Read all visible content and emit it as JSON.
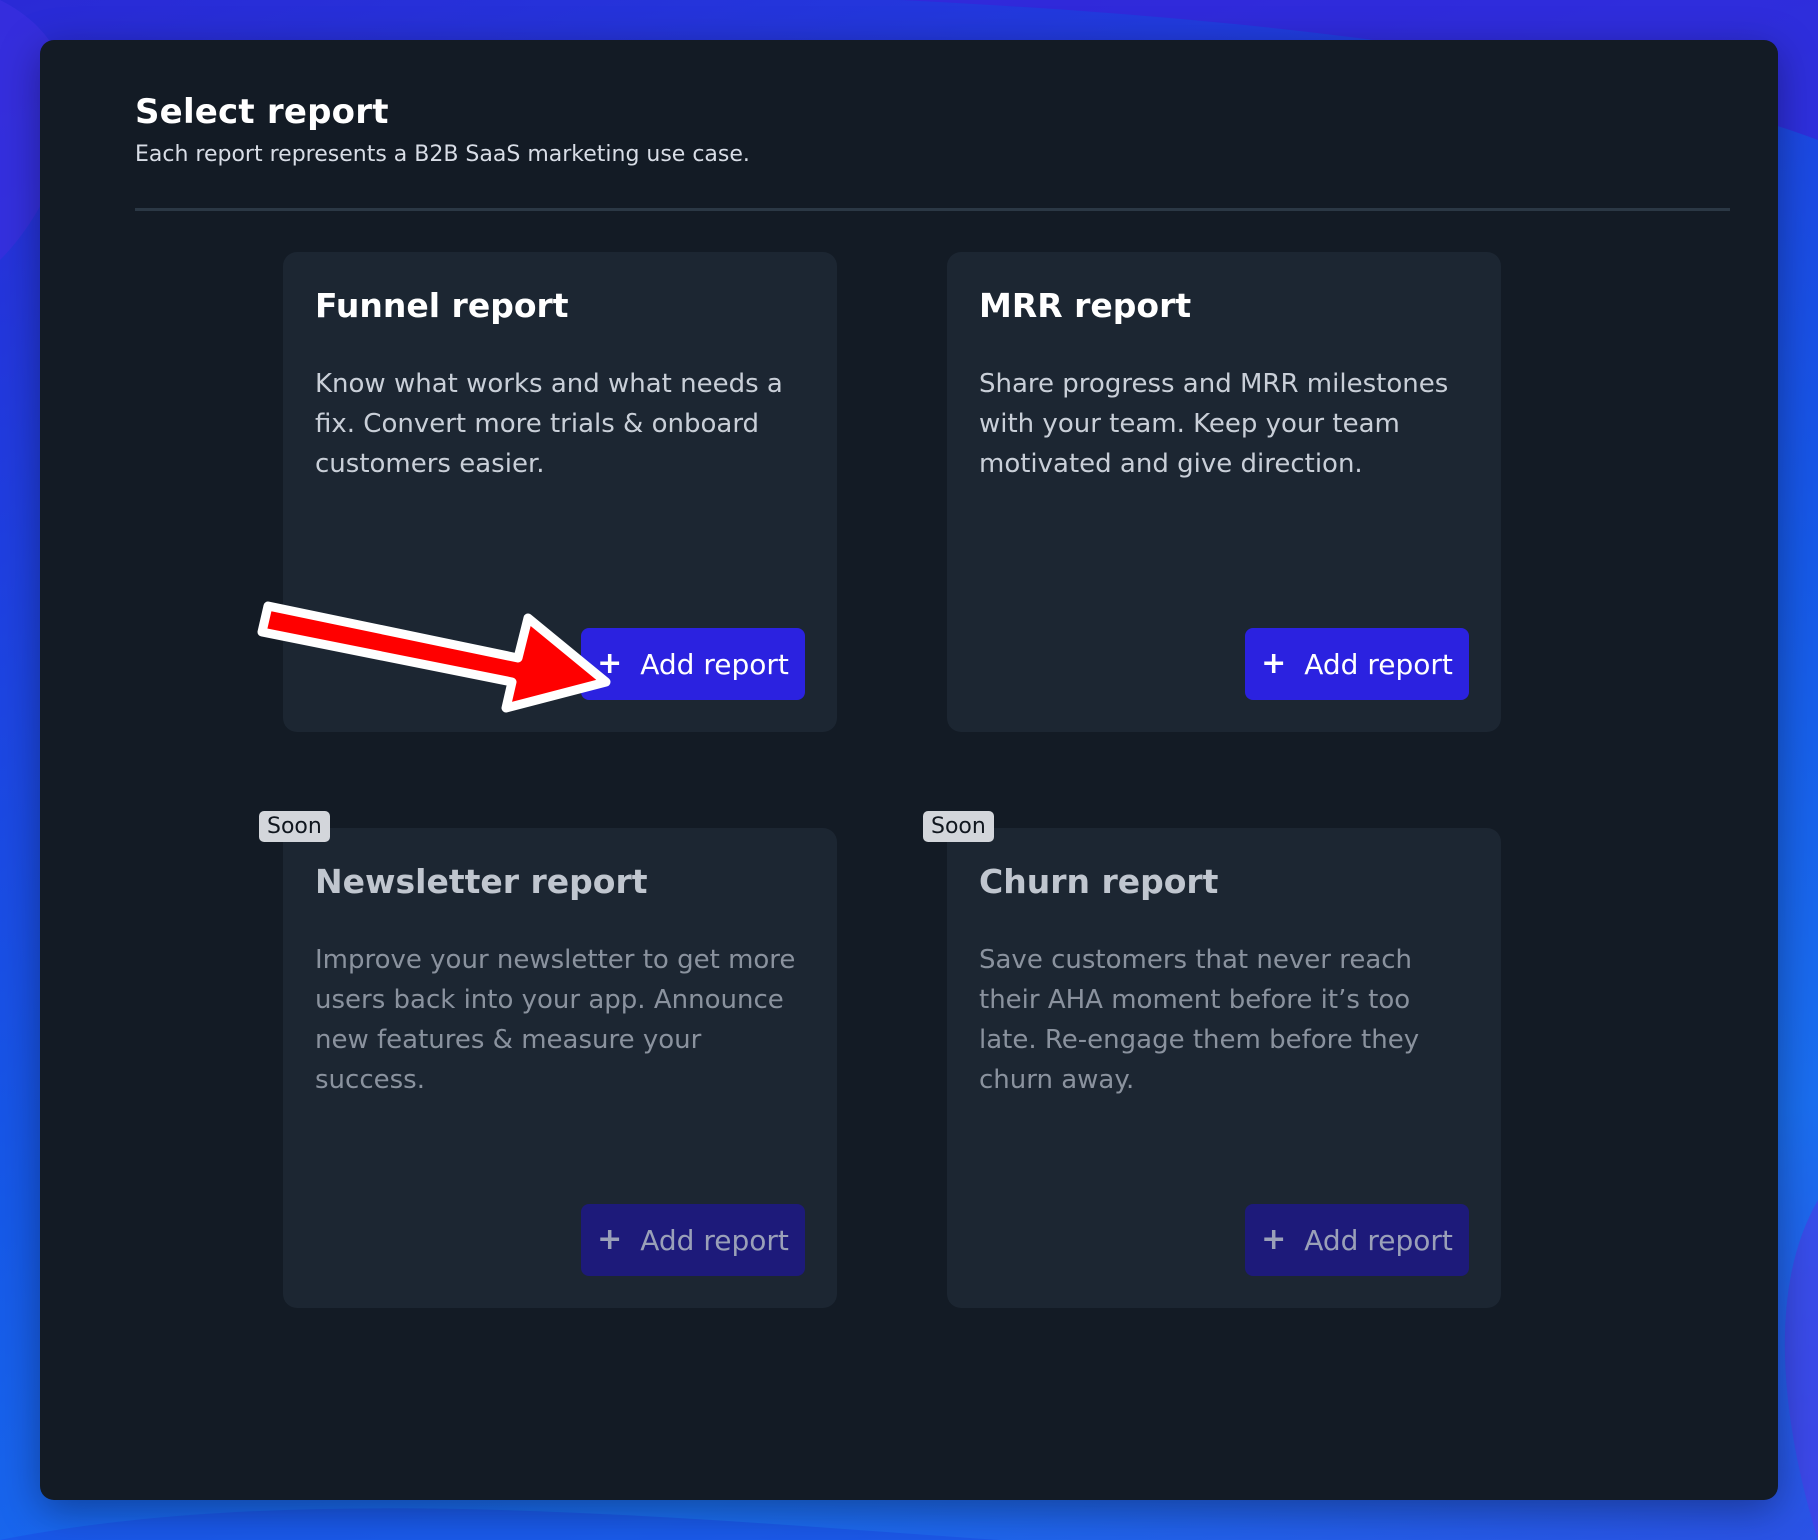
{
  "header": {
    "title": "Select report",
    "subtitle": "Each report represents a B2B SaaS marketing use case."
  },
  "cards": [
    {
      "title": "Funnel report",
      "description": "Know what works and what needs a fix. Convert more trials & onboard customers easier.",
      "button_label": "Add report",
      "button_icon": "plus-icon"
    },
    {
      "title": "MRR report",
      "description": "Share progress and MRR milestones with your team. Keep your team motivated and give direction.",
      "button_label": "Add report",
      "button_icon": "plus-icon"
    },
    {
      "title": "Newsletter report",
      "description": "Improve your newsletter to get more users back into your app. Announce new features & measure your success.",
      "button_label": "Add report",
      "button_icon": "plus-icon",
      "badge": "Soon"
    },
    {
      "title": "Churn report",
      "description": "Save customers that never reach their AHA moment before it’s too late. Re-engage them before they churn away.",
      "button_label": "Add report",
      "button_icon": "plus-icon",
      "badge": "Soon"
    }
  ],
  "colors": {
    "panel_bg": "#131b25",
    "card_bg": "#1c2632",
    "button_bg": "#2b22e0",
    "button_disabled_bg": "#1d1a7a",
    "badge_bg": "#d3d6db",
    "annotation_arrow": "#ff0000"
  },
  "annotation": {
    "icon": "red-arrow-icon"
  }
}
